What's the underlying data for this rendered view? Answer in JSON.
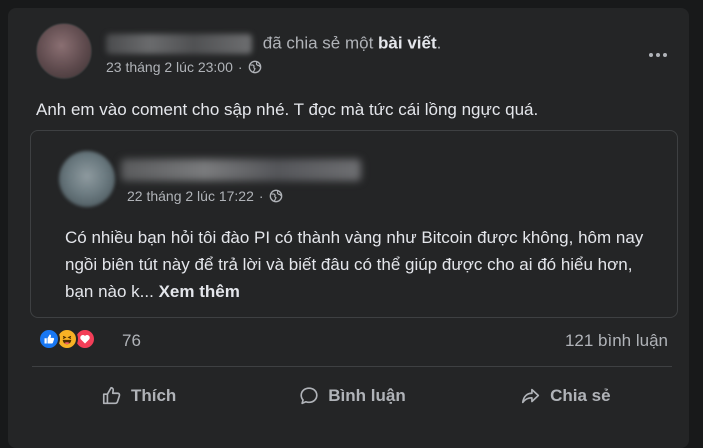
{
  "post": {
    "author_name": "",
    "shared_text": "đã chia sẻ một",
    "shared_object": "bài viết",
    "suffix": ".",
    "timestamp": "23 tháng 2 lúc 23:00",
    "separator": "·",
    "privacy_icon": "globe-icon",
    "more_icon": "more-options-icon",
    "text": "Anh em vào coment cho sập nhé. T đọc mà tức cái lồng ngực quá."
  },
  "shared_post": {
    "author_name": "",
    "timestamp": "22 tháng 2 lúc 17:22",
    "separator": "·",
    "privacy_icon": "globe-icon",
    "body": "Có nhiều bạn hỏi tôi đào PI có thành vàng như Bitcoin được không, hôm nay ngồi biên tút này để trả lời và biết đâu có thể giúp được cho ai đó hiểu hơn, bạn nào k...",
    "see_more": "Xem thêm"
  },
  "reactions": {
    "types": [
      "like-icon",
      "haha-icon",
      "love-icon"
    ],
    "count": "76",
    "comments": "121 bình luận"
  },
  "actions": {
    "like": "Thích",
    "comment": "Bình luận",
    "share": "Chia sẻ"
  },
  "colors": {
    "background": "#18191a",
    "card": "#242526",
    "primary_text": "#e4e6eb",
    "secondary_text": "#b0b3b8",
    "like_blue": "#1877f2",
    "haha_yellow": "#f7b125",
    "love_red": "#f33e58"
  }
}
